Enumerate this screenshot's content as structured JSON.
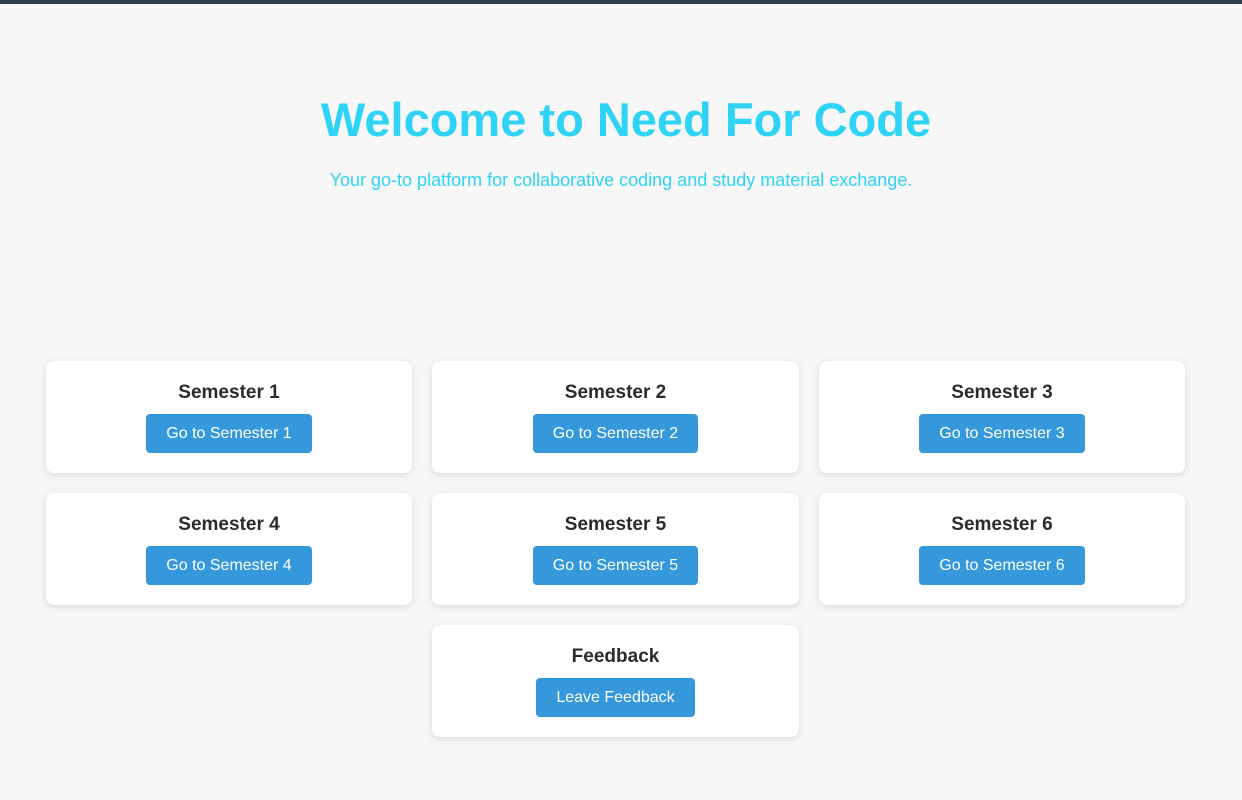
{
  "hero": {
    "title": "Welcome to Need For Code",
    "subtitle": "Your go-to platform for collaborative coding and study material exchange."
  },
  "cards": [
    {
      "title": "Semester 1",
      "button": "Go to Semester 1"
    },
    {
      "title": "Semester 2",
      "button": "Go to Semester 2"
    },
    {
      "title": "Semester 3",
      "button": "Go to Semester 3"
    },
    {
      "title": "Semester 4",
      "button": "Go to Semester 4"
    },
    {
      "title": "Semester 5",
      "button": "Go to Semester 5"
    },
    {
      "title": "Semester 6",
      "button": "Go to Semester 6"
    },
    {
      "title": "Feedback",
      "button": "Leave Feedback"
    }
  ],
  "colors": {
    "top_bar": "#2c3e50",
    "accent_text": "#2ed3f6",
    "button": "#3498db",
    "background": "#f7f7f7"
  }
}
